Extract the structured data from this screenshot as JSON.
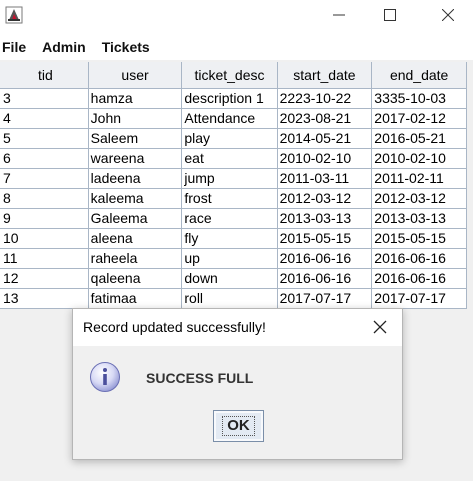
{
  "window": {
    "app_icon": "java-app-icon",
    "controls": [
      "minimize-icon",
      "maximize-icon",
      "close-icon"
    ]
  },
  "menu": {
    "items": [
      {
        "label": "File"
      },
      {
        "label": "Admin"
      },
      {
        "label": "Tickets"
      }
    ]
  },
  "table": {
    "columns": [
      "tid",
      "user",
      "ticket_desc",
      "start_date",
      "end_date"
    ],
    "rows": [
      [
        "3",
        "hamza",
        "description 1",
        "2223-10-22",
        "3335-10-03"
      ],
      [
        "4",
        "John",
        "Attendance",
        "2023-08-21",
        "2017-02-12"
      ],
      [
        "5",
        "Saleem",
        "play",
        "2014-05-21",
        "2016-05-21"
      ],
      [
        "6",
        "wareena",
        "eat",
        "2010-02-10",
        "2010-02-10"
      ],
      [
        "7",
        "ladeena",
        "jump",
        "2011-03-11",
        "2011-02-11"
      ],
      [
        "8",
        "kaleema",
        "frost",
        "2012-03-12",
        "2012-03-12"
      ],
      [
        "9",
        "Galeema",
        "race",
        "2013-03-13",
        "2013-03-13"
      ],
      [
        "10",
        "aleena",
        "fly",
        "2015-05-15",
        "2015-05-15"
      ],
      [
        "11",
        "raheela",
        "up",
        "2016-06-16",
        "2016-06-16"
      ],
      [
        "12",
        "qaleena",
        "down",
        "2016-06-16",
        "2016-06-16"
      ],
      [
        "13",
        "fatimaa",
        "roll",
        "2017-07-17",
        "2017-07-17"
      ]
    ]
  },
  "dialog": {
    "title": "Record updated successfully!",
    "message": "SUCCESS FULL",
    "ok_label": "OK",
    "icon": "info-icon"
  }
}
